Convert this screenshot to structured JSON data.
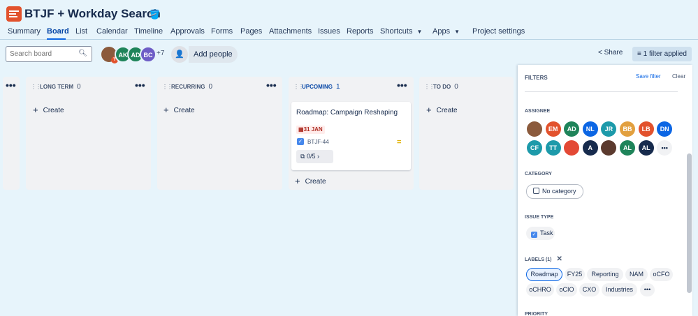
{
  "project": {
    "title": "BTJF + Workday Search"
  },
  "nav": {
    "items": [
      "Summary",
      "Board",
      "List",
      "Calendar",
      "Timeline",
      "Approvals",
      "Forms",
      "Pages",
      "Attachments",
      "Issues",
      "Reports",
      "Shortcuts",
      "Apps",
      "Project settings"
    ],
    "active": "Board"
  },
  "toolbar": {
    "search_placeholder": "Search board",
    "avatars": [
      {
        "initials": "",
        "color": "#8b5a3c"
      },
      {
        "initials": "AK",
        "color": "#1f845a"
      },
      {
        "initials": "AD",
        "color": "#1f845a"
      },
      {
        "initials": "BC",
        "color": "#6e5dc6"
      }
    ],
    "more_count": "+7",
    "add_people": "Add people",
    "share": "Share",
    "filter_applied": "1 filter applied"
  },
  "board": {
    "columns": [
      {
        "name": "LONG TERM",
        "count": "0",
        "create": "Create"
      },
      {
        "name": "RECURRING",
        "count": "0",
        "create": "Create"
      },
      {
        "name": "UPCOMING",
        "count": "1",
        "create": "Create"
      },
      {
        "name": "TO DO",
        "count": "0",
        "create": "Create"
      }
    ],
    "card": {
      "title": "Roadmap: Campaign Reshaping",
      "due": "31 JAN",
      "key": "BTJF-44",
      "subtasks": "0/5"
    }
  },
  "filters": {
    "title": "FILTERS",
    "save_filter": "Save filter",
    "clear": "Clear",
    "assignee_label": "ASSIGNEE",
    "assignees": [
      {
        "initials": "",
        "color": "#8b5a3c"
      },
      {
        "initials": "EM",
        "color": "#e2522d"
      },
      {
        "initials": "AD",
        "color": "#1f845a"
      },
      {
        "initials": "NL",
        "color": "#0c66e4"
      },
      {
        "initials": "JR",
        "color": "#1d9aaa"
      },
      {
        "initials": "BB",
        "color": "#e2a03f"
      },
      {
        "initials": "LB",
        "color": "#e2522d"
      },
      {
        "initials": "DN",
        "color": "#0c66e4"
      },
      {
        "initials": "CF",
        "color": "#1d9aaa"
      },
      {
        "initials": "TT",
        "color": "#1d9aaa"
      },
      {
        "initials": "",
        "color": "#e34935"
      },
      {
        "initials": "A",
        "color": "#172b4d"
      },
      {
        "initials": "",
        "color": "#5b3a2e"
      },
      {
        "initials": "AL",
        "color": "#1f845a"
      },
      {
        "initials": "AL",
        "color": "#172b4d"
      }
    ],
    "category_label": "CATEGORY",
    "category_option": "No category",
    "issue_type_label": "ISSUE TYPE",
    "issue_type_option": "Task",
    "labels_label": "LABELS (1)",
    "labels": [
      "Roadmap",
      "FY25",
      "Reporting",
      "NAM",
      "oCFO",
      "oCHRO",
      "oCIO",
      "CXO",
      "Industries"
    ],
    "priority_label": "PRIORITY"
  }
}
